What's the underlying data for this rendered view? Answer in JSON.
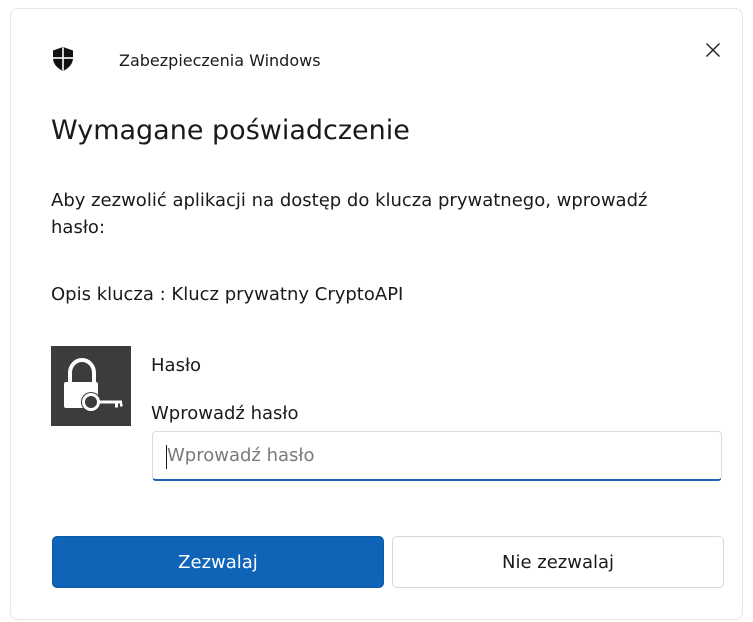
{
  "header": {
    "app_title": "Zabezpieczenia Windows",
    "shield_icon": "windows-security-shield-icon",
    "close_icon": "close-icon"
  },
  "dialog": {
    "heading": "Wymagane poświadczenie",
    "description": "Aby zezwolić aplikacji na dostęp do klucza prywatnego, wprowadź hasło:",
    "key_description": "Opis klucza  : Klucz prywatny CryptoAPI"
  },
  "credential": {
    "tile_icon": "lock-key-icon",
    "field_label": "Hasło",
    "input_label": "Wprowadź hasło",
    "input_placeholder": "Wprowadź hasło",
    "input_value": ""
  },
  "buttons": {
    "allow_label": "Zezwalaj",
    "deny_label": "Nie zezwalaj"
  },
  "colors": {
    "accent": "#0f64b8",
    "tile_background": "#3c3c3c"
  }
}
